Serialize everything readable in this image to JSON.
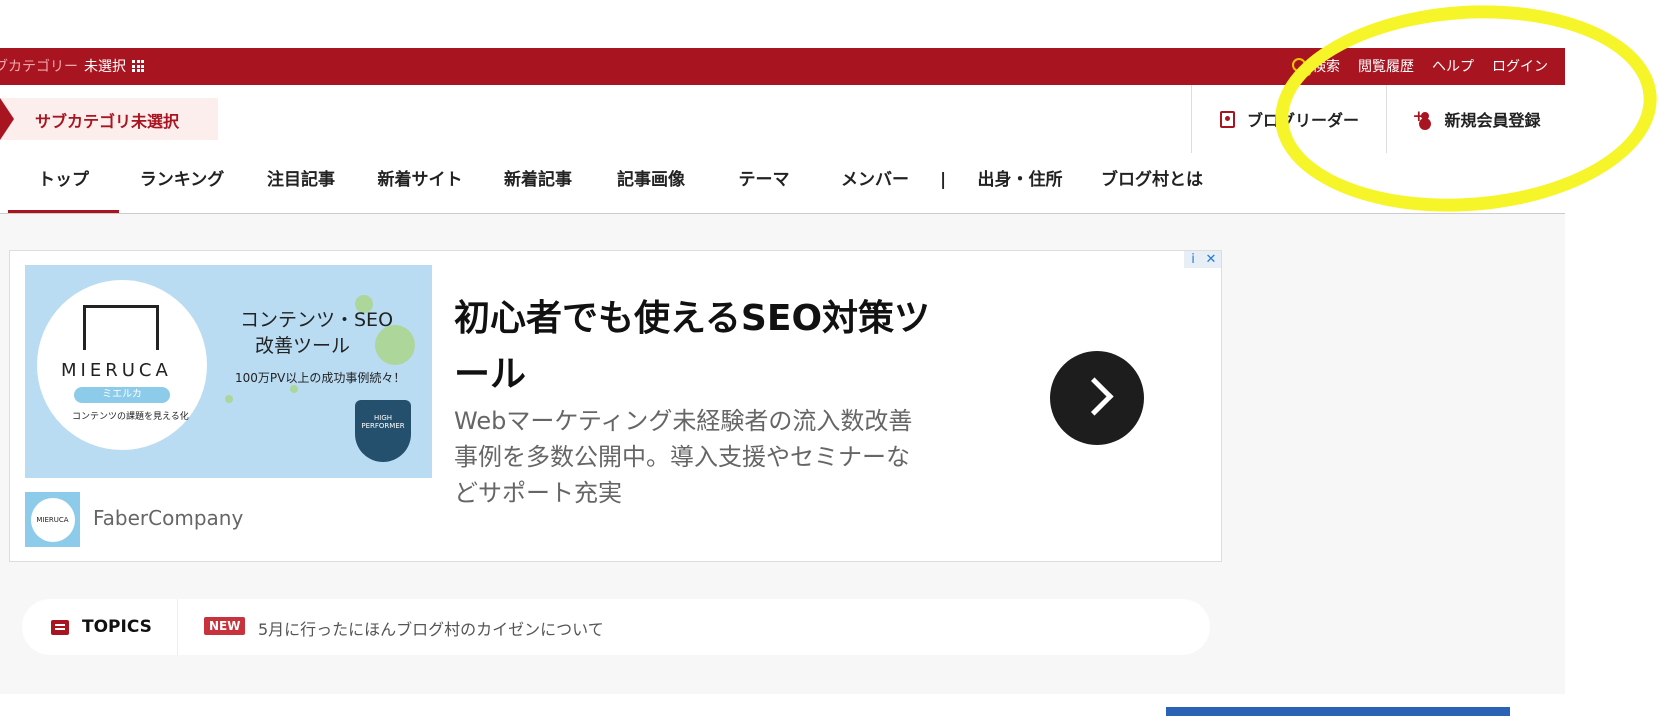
{
  "topbar": {
    "category_label": "ブカテゴリー",
    "category_value": "未選択",
    "links": [
      "検索",
      "閲覧履歴",
      "ヘルプ",
      "ログイン"
    ]
  },
  "subbar": {
    "subcategory": "サブカテゴリ未選択",
    "reader": "ブログリーダー",
    "signup": "新規会員登録"
  },
  "nav": {
    "tabs": [
      "トップ",
      "ランキング",
      "注目記事",
      "新着サイト",
      "新着記事",
      "記事画像",
      "テーマ",
      "メンバー",
      "出身・住所",
      "ブログ村とは"
    ],
    "separator": "|"
  },
  "ad": {
    "image_title_1": "コンテンツ・SEO",
    "image_title_2": "改善ツール",
    "image_tagline": "100万PV以上の成功事例続々！",
    "brand": "MIERUCA",
    "brand_pill": "ミエルカ",
    "brand_caption": "コンテンツの課題を見える化",
    "badge": "HIGH PERFORMER",
    "advertiser": "FaberCompany",
    "headline": "初心者でも使えるSEO対策ツール",
    "description": "Webマーケティング未経験者の流入数改善事例を多数公開中。導入支援やセミナーなどサポート充実",
    "info_icon": "i",
    "close_icon": "✕"
  },
  "topics": {
    "label": "TOPICS",
    "badge": "NEW",
    "text": "5月に行ったにほんブログ村のカイゼンについて"
  },
  "colors": {
    "brand_red": "#a81520",
    "highlight": "#f6f52a"
  }
}
